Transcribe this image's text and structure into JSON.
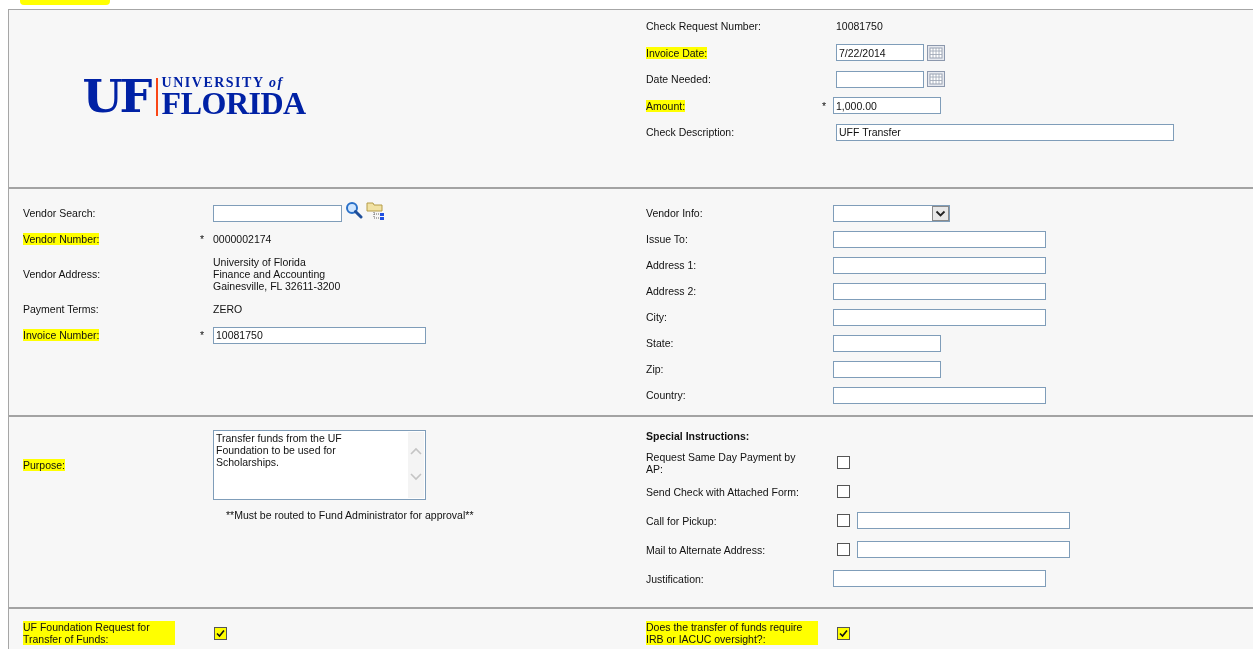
{
  "logo": {
    "monogram": "UF",
    "top": "UNIVERSITY *of*",
    "name": "FLORIDA"
  },
  "sections": [
    {
      "kind": "header",
      "right": [
        {
          "label": "Check Request Number:",
          "highlighted": false,
          "kind": "text",
          "value": "10081750"
        },
        {
          "label": "Invoice Date:",
          "highlighted": true,
          "kind": "date",
          "value": "7/22/2014"
        },
        {
          "label": "Date Needed:",
          "highlighted": false,
          "kind": "date"
        },
        {
          "label": "Amount:",
          "highlighted": true,
          "marker": "*",
          "kind": "short-input",
          "value": "1,000.00"
        },
        {
          "label": "Check Description:",
          "highlighted": false,
          "kind": "long-input",
          "value": "UFF Transfer"
        }
      ]
    },
    {
      "kind": "vendor",
      "left": [
        {
          "label": "Vendor Search:",
          "highlighted": false,
          "kind": "search"
        },
        {
          "label": "Vendor Number:",
          "highlighted": true,
          "marker": "*",
          "kind": "text",
          "value": "0000002174"
        },
        {
          "label": "Vendor Address:",
          "highlighted": false,
          "kind": "address",
          "lines": [
            "University of Florida",
            "Finance and Accounting",
            "Gainesville, FL 32611-3200"
          ]
        },
        {
          "label": "Payment Terms:",
          "highlighted": false,
          "kind": "text",
          "value": "ZERO"
        },
        {
          "label": "Invoice Number:",
          "highlighted": true,
          "marker": "*",
          "kind": "input",
          "value": "10081750"
        }
      ],
      "right": [
        {
          "label": "Vendor Info:",
          "highlighted": false,
          "kind": "select"
        },
        {
          "label": "Issue To:",
          "highlighted": false,
          "kind": "input"
        },
        {
          "label": "Address 1:",
          "highlighted": false,
          "kind": "input"
        },
        {
          "label": "Address 2:",
          "highlighted": false,
          "kind": "input"
        },
        {
          "label": "City:",
          "highlighted": false,
          "kind": "input"
        },
        {
          "label": "State:",
          "highlighted": false,
          "kind": "short-input"
        },
        {
          "label": "Zip:",
          "highlighted": false,
          "kind": "short-input"
        },
        {
          "label": "Country:",
          "highlighted": false,
          "kind": "input"
        }
      ]
    },
    {
      "kind": "purpose",
      "left": [
        {
          "label": "Purpose:",
          "highlighted": true,
          "kind": "textarea",
          "value": "Transfer funds from the UF Foundation to be used for Scholarships.",
          "note": "**Must be routed to Fund Administrator for approval**"
        }
      ],
      "right": [
        {
          "label": "Special Instructions:",
          "kind": "heading"
        },
        {
          "label": "Request Same Day Payment by AP:",
          "highlighted": false,
          "kind": "checkbox",
          "checked": false
        },
        {
          "label": "Send Check with Attached Form:",
          "highlighted": false,
          "kind": "checkbox",
          "checked": false
        },
        {
          "label": "Call for Pickup:",
          "highlighted": false,
          "kind": "checkbox-input",
          "checked": false
        },
        {
          "label": "Mail to Alternate Address:",
          "highlighted": false,
          "kind": "checkbox-input",
          "checked": false
        },
        {
          "label": "Justification:",
          "highlighted": false,
          "kind": "input"
        }
      ]
    },
    {
      "kind": "foundation",
      "left": [
        {
          "label": "UF Foundation Request for Transfer of Funds:",
          "highlighted": true,
          "kind": "checkbox",
          "checked": true
        }
      ],
      "right": [
        {
          "label": "Does the transfer of funds require IRB or IACUC oversight?:",
          "highlighted": true,
          "kind": "checkbox",
          "checked": true
        }
      ]
    }
  ]
}
